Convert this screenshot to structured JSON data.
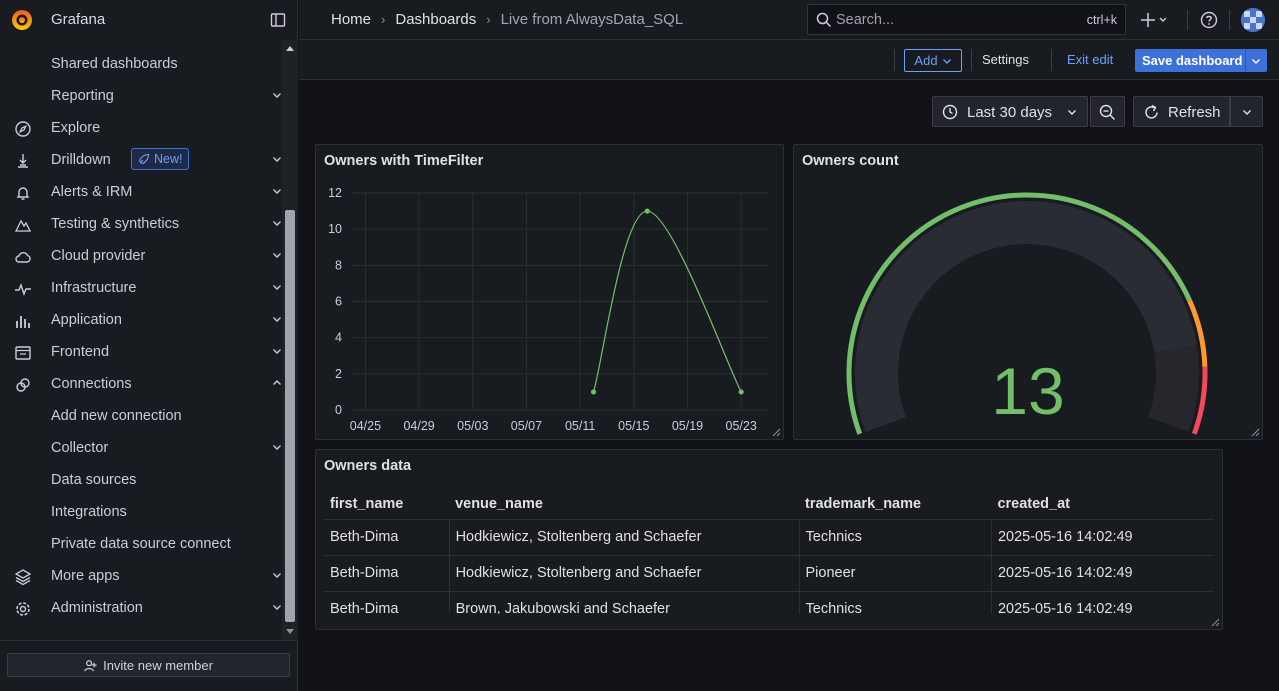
{
  "app": {
    "name": "Grafana"
  },
  "sidebar": {
    "items": [
      {
        "label": "Shared dashboards",
        "icon": "none",
        "chevron": false,
        "indent": true
      },
      {
        "label": "Reporting",
        "icon": "none",
        "chevron": true,
        "indent": true
      },
      {
        "label": "Explore",
        "icon": "compass-icon",
        "chevron": false
      },
      {
        "label": "Drilldown",
        "icon": "drilldown-icon",
        "chevron": true,
        "badge": "New!"
      },
      {
        "label": "Alerts & IRM",
        "icon": "bell-icon",
        "chevron": true
      },
      {
        "label": "Testing & synthetics",
        "icon": "k6-icon",
        "chevron": true
      },
      {
        "label": "Cloud provider",
        "icon": "cloud-icon",
        "chevron": true
      },
      {
        "label": "Infrastructure",
        "icon": "heartbeat-icon",
        "chevron": true
      },
      {
        "label": "Application",
        "icon": "bar-chart-icon",
        "chevron": true
      },
      {
        "label": "Frontend",
        "icon": "frontend-icon",
        "chevron": true
      },
      {
        "label": "Connections",
        "icon": "link-icon",
        "chevron": true,
        "expanded": true
      },
      {
        "label": "Add new connection",
        "icon": "none",
        "chevron": false,
        "indent": true
      },
      {
        "label": "Collector",
        "icon": "none",
        "chevron": true,
        "indent": true
      },
      {
        "label": "Data sources",
        "icon": "none",
        "chevron": false,
        "indent": true
      },
      {
        "label": "Integrations",
        "icon": "none",
        "chevron": false,
        "indent": true
      },
      {
        "label": "Private data source connect",
        "icon": "none",
        "chevron": false,
        "indent": true
      },
      {
        "label": "More apps",
        "icon": "layers-icon",
        "chevron": true
      },
      {
        "label": "Administration",
        "icon": "gear-icon",
        "chevron": true
      }
    ],
    "invite_label": "Invite new member"
  },
  "topbar": {
    "breadcrumbs": [
      "Home",
      "Dashboards",
      "Live from AlwaysData_SQL"
    ],
    "search_placeholder": "Search...",
    "search_shortcut": "ctrl+k"
  },
  "editbar": {
    "add_label": "Add",
    "settings_label": "Settings",
    "exit_label": "Exit edit",
    "save_label": "Save dashboard"
  },
  "timecontrols": {
    "range_label": "Last 30 days",
    "refresh_label": "Refresh"
  },
  "panels": {
    "timeseries_title": "Owners with TimeFilter",
    "gauge_title": "Owners count",
    "gauge_value": "13",
    "table_title": "Owners data"
  },
  "chart_data": {
    "type": "line",
    "title": "Owners with TimeFilter",
    "x_ticks": [
      "04/25",
      "04/29",
      "05/03",
      "05/07",
      "05/11",
      "05/15",
      "05/19",
      "05/23"
    ],
    "y_ticks": [
      "0",
      "2",
      "4",
      "6",
      "8",
      "10",
      "12"
    ],
    "ylim": [
      0,
      12
    ],
    "xlim": [
      "04/24",
      "05/25"
    ],
    "grid": true,
    "series": [
      {
        "color": "#73bf69",
        "points": [
          {
            "x": "05/12",
            "y": 1
          },
          {
            "x": "05/16",
            "y": 11
          },
          {
            "x": "05/23",
            "y": 1
          }
        ]
      }
    ]
  },
  "gauge": {
    "value": 13,
    "min": 0,
    "max": 15,
    "thresholds": [
      {
        "from": 0,
        "color": "#73bf69"
      },
      {
        "from": 12,
        "color": "#ff9830"
      },
      {
        "from": 13.5,
        "color": "#f2495c"
      }
    ]
  },
  "table": {
    "columns": [
      "first_name",
      "venue_name",
      "trademark_name",
      "created_at"
    ],
    "rows": [
      [
        "Beth-Dima",
        "Hodkiewicz, Stoltenberg and Schaefer",
        "Technics",
        "2025-05-16 14:02:49"
      ],
      [
        "Beth-Dima",
        "Hodkiewicz, Stoltenberg and Schaefer",
        "Pioneer",
        "2025-05-16 14:02:49"
      ],
      [
        "Beth-Dima",
        "Brown, Jakubowski and Schaefer",
        "Technics",
        "2025-05-16 14:02:49"
      ]
    ]
  },
  "colors": {
    "accent": "#3d71d9",
    "link": "#6e9fff",
    "green": "#73bf69",
    "orange": "#ff9830",
    "red": "#f2495c"
  }
}
